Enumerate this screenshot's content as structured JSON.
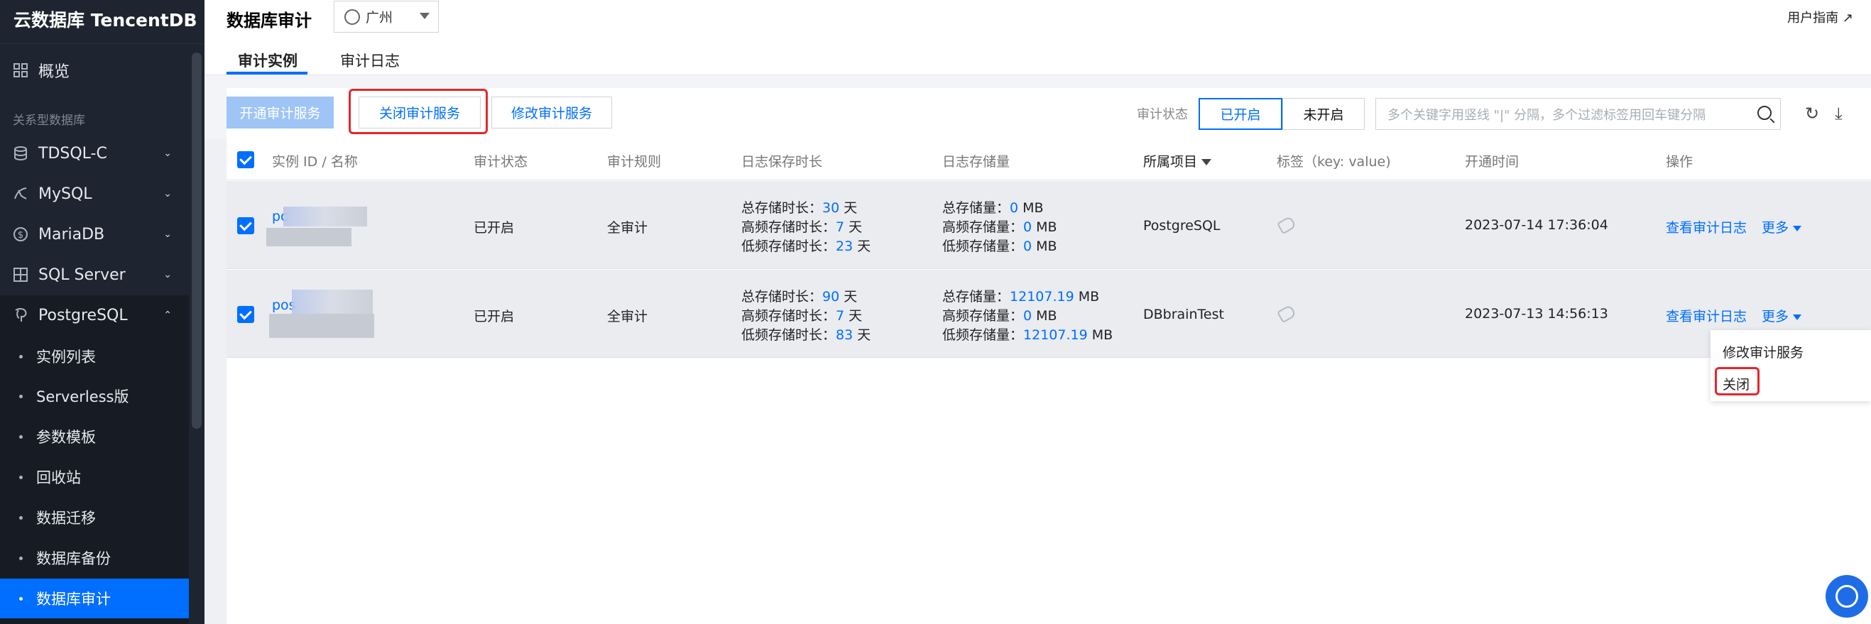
{
  "sidebar": {
    "brand": "云数据库 TencentDB",
    "overview": "概览",
    "section": "关系型数据库",
    "items": [
      {
        "label": "TDSQL-C"
      },
      {
        "label": "MySQL"
      },
      {
        "label": "MariaDB"
      },
      {
        "label": "SQL Server"
      },
      {
        "label": "PostgreSQL"
      }
    ],
    "sub_items": [
      {
        "label": "实例列表"
      },
      {
        "label": "Serverless版"
      },
      {
        "label": "参数模板"
      },
      {
        "label": "回收站"
      },
      {
        "label": "数据迁移"
      },
      {
        "label": "数据库备份"
      },
      {
        "label": "数据库审计"
      }
    ]
  },
  "header": {
    "title": "数据库审计",
    "region": "广州",
    "user_guide": "用户指南",
    "tabs": [
      {
        "label": "审计实例"
      },
      {
        "label": "审计日志"
      }
    ]
  },
  "toolbar": {
    "open_audit": "开通审计服务",
    "close_audit": "关闭审计服务",
    "modify_audit": "修改审计服务",
    "status_label": "审计状态",
    "status_on": "已开启",
    "status_off": "未开启",
    "search_placeholder": "多个关键字用竖线 \"|\" 分隔，多个过滤标签用回车键分隔"
  },
  "table": {
    "headers": {
      "id_name": "实例 ID / 名称",
      "audit_status": "审计状态",
      "audit_rule": "审计规则",
      "log_retention": "日志保存时长",
      "log_storage": "日志存储量",
      "project": "所属项目",
      "tags": "标签（key: value)",
      "open_time": "开通时间",
      "actions": "操作"
    },
    "rows": [
      {
        "id_prefix": "pc",
        "id_line2": "..",
        "status": "已开启",
        "rule": "全审计",
        "ret_total_label": "总存储时长：",
        "ret_total": "30",
        "ret_high_label": "高频存储时长：",
        "ret_high": "7",
        "ret_low_label": "低频存储时长：",
        "ret_low": "23",
        "day": "天",
        "st_total_label": "总存储量：",
        "st_total": "0",
        "st_high_label": "高频存储量：",
        "st_high": "0",
        "st_low_label": "低频存储量：",
        "st_low": "0",
        "mb": "MB",
        "project": "PostgreSQL",
        "open_time": "2023-07-14 17:36:04",
        "view_log": "查看审计日志",
        "more": "更多"
      },
      {
        "id_prefix": "pos",
        "id_line2": "",
        "status": "已开启",
        "rule": "全审计",
        "ret_total_label": "总存储时长：",
        "ret_total": "90",
        "ret_high_label": "高频存储时长：",
        "ret_high": "7",
        "ret_low_label": "低频存储时长：",
        "ret_low": "83",
        "day": "天",
        "st_total_label": "总存储量：",
        "st_total": "12107.19",
        "st_high_label": "高频存储量：",
        "st_high": "0",
        "st_low_label": "低频存储量：",
        "st_low": "12107.19",
        "mb": "MB",
        "project": "DBbrainTest",
        "open_time": "2023-07-13 14:56:13",
        "view_log": "查看审计日志",
        "more": "更多"
      }
    ]
  },
  "dropdown": {
    "modify": "修改审计服务",
    "close": "关闭"
  },
  "colors": {
    "accent": "#006eff",
    "sidebar_bg": "#1e2530",
    "highlight": "#e5262b"
  }
}
